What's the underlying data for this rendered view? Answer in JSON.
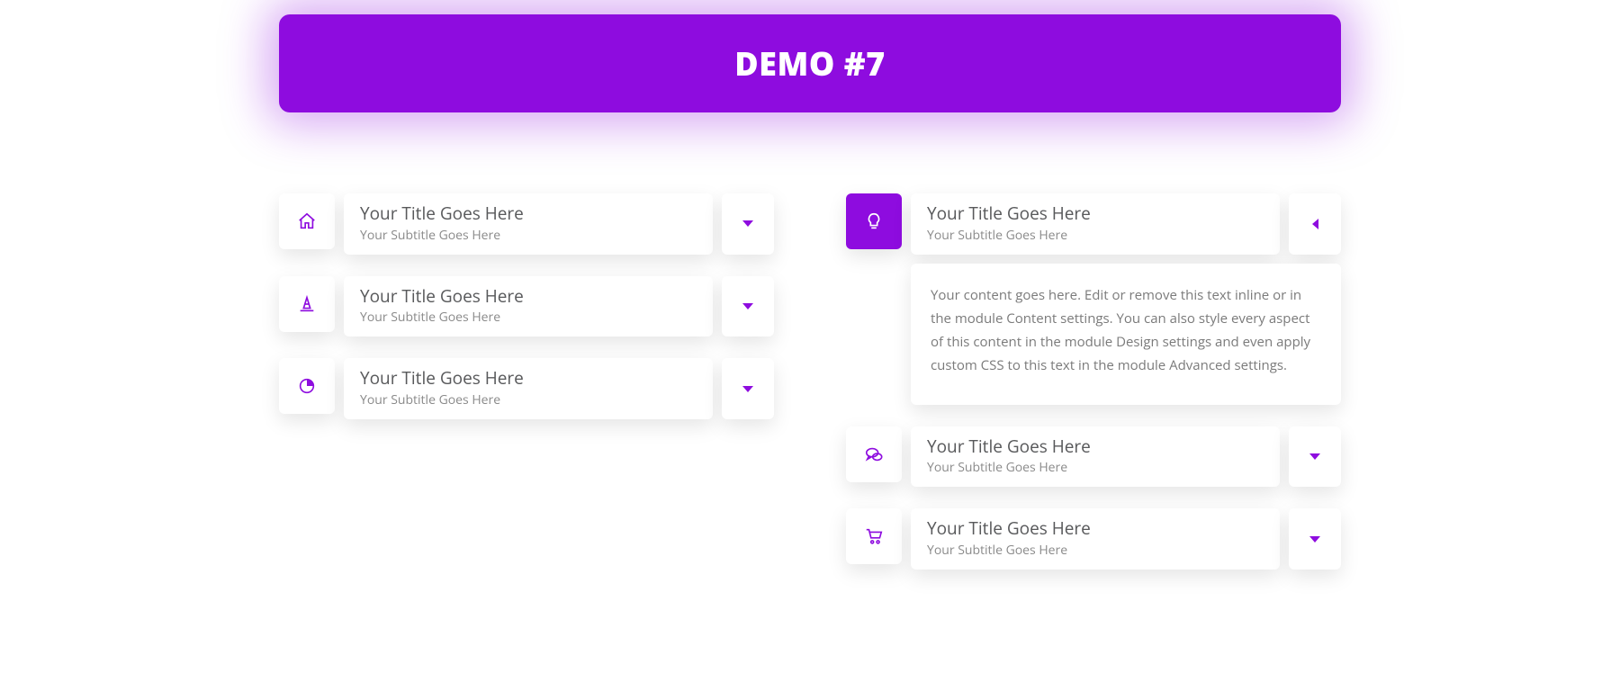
{
  "banner": {
    "title": "DEMO #7"
  },
  "common": {
    "title": "Your Title Goes Here",
    "subtitle": "Your Subtitle Goes Here",
    "content": "Your content goes here. Edit or remove this text inline or in the module Content settings. You can also style every aspect of this content in the module Design settings and even apply custom CSS to this text in the module Advanced settings."
  },
  "left": {
    "items": [
      {
        "icon": "home",
        "title": "Your Title Goes Here",
        "subtitle": "Your Subtitle Goes Here"
      },
      {
        "icon": "cone",
        "title": "Your Title Goes Here",
        "subtitle": "Your Subtitle Goes Here"
      },
      {
        "icon": "chart",
        "title": "Your Title Goes Here",
        "subtitle": "Your Subtitle Goes Here"
      }
    ]
  },
  "right": {
    "items": [
      {
        "icon": "bulb",
        "title": "Your Title Goes Here",
        "subtitle": "Your Subtitle Goes Here",
        "open": true
      },
      {
        "icon": "chat",
        "title": "Your Title Goes Here",
        "subtitle": "Your Subtitle Goes Here",
        "open": false
      },
      {
        "icon": "cart",
        "title": "Your Title Goes Here",
        "subtitle": "Your Subtitle Goes Here",
        "open": false
      }
    ]
  },
  "colors": {
    "accent": "#8e0cdf"
  }
}
